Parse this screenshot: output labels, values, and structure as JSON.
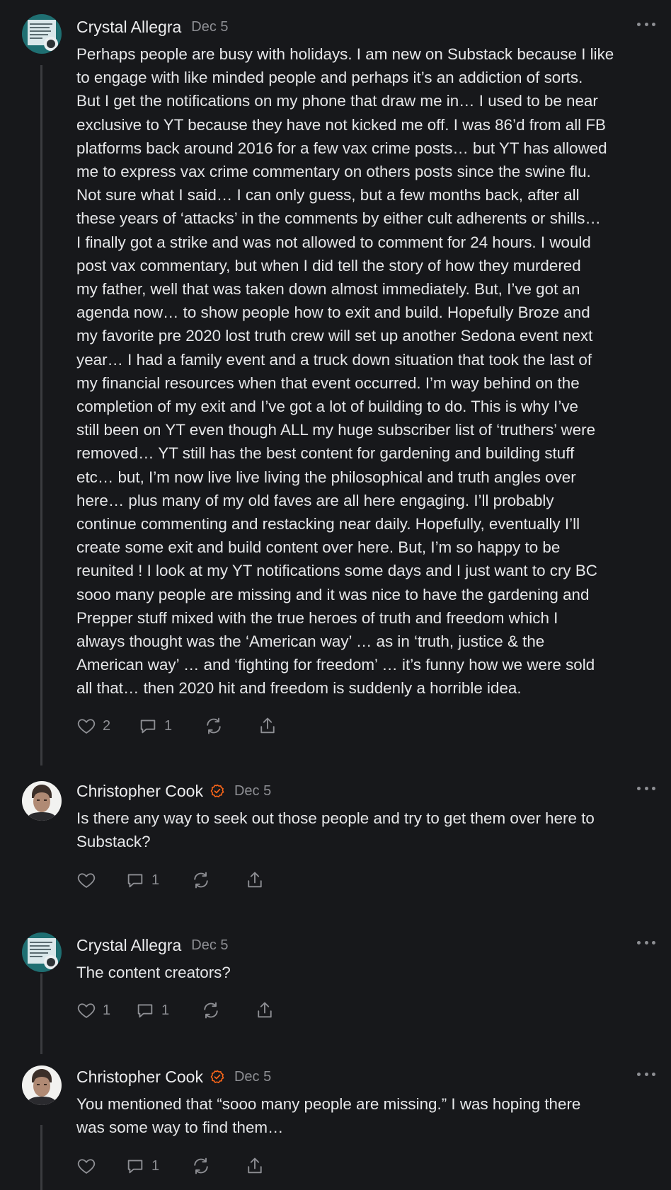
{
  "comments": [
    {
      "author": "Crystal Allegra",
      "verified": false,
      "date": "Dec 5",
      "text": "Perhaps people are busy with holidays. I am new on Substack because I like\nto engage with like minded people and perhaps it’s an addiction of sorts.\nBut I get the notifications on my phone that draw me in… I used to be near\nexclusive to YT because they have not kicked me off. I was 86’d from all FB\nplatforms back around 2016 for a few vax crime posts… but YT has allowed\nme to express vax crime commentary on others posts since the swine flu.\nNot sure what I said… I can only guess, but a few months back, after all\nthese years of ‘attacks’ in the comments by either cult adherents or shills…\nI finally got a strike and was not allowed to comment for 24 hours. I would\npost vax commentary, but when I did tell the story of how they murdered\nmy father, well that was taken down almost immediately. But, I’ve got an\nagenda now… to show people how to exit and build. Hopefully Broze and\nmy favorite pre 2020 lost truth crew will set up another Sedona event next\nyear… I had a family event and a truck down situation that took the last of\nmy financial resources when that event occurred. I’m way behind on the\ncompletion of my exit and I’ve got a lot of building to do. This is why I’ve\nstill been on YT even though ALL my huge subscriber list of ‘truthers’ were\nremoved… YT still has the best content for gardening and building stuff\netc… but, I’m now live live living the philosophical and truth angles over\nhere… plus many of my old faves are all here engaging. I’ll probably\ncontinue commenting and restacking near daily. Hopefully, eventually I’ll\ncreate some exit and build content over here. But, I’m so happy to be\nreunited ! I look at my YT notifications some days and I just want to cry BC\nsooo many people are missing and it was nice to have the gardening and\nPrepper stuff mixed with the true heroes of truth and freedom which I\nalways thought was the ‘American way’ … as in ‘truth, justice & the\nAmerican way’ … and ‘fighting for freedom’ … it’s funny how we were sold\nall that… then 2020 hit and freedom is suddenly a horrible idea.",
      "likes": "2",
      "replies": "1"
    },
    {
      "author": "Christopher Cook",
      "verified": true,
      "date": "Dec 5",
      "text": "Is there any way to seek out those people and try to get them over here to\nSubstack?",
      "likes": "",
      "replies": "1"
    },
    {
      "author": "Crystal Allegra",
      "verified": false,
      "date": "Dec 5",
      "text": "The content creators?",
      "likes": "1",
      "replies": "1"
    },
    {
      "author": "Christopher Cook",
      "verified": true,
      "date": "Dec 5",
      "text": "You mentioned that “sooo many people are missing.” I was hoping there\nwas some way to find them…",
      "likes": "",
      "replies": "1"
    }
  ],
  "icons": [
    "heart-icon",
    "comment-icon",
    "restack-icon",
    "share-icon",
    "more-icon",
    "verified-icon"
  ],
  "colors": {
    "background": "#17181b",
    "verified": "#ff6719",
    "muted": "#8e8f94"
  }
}
